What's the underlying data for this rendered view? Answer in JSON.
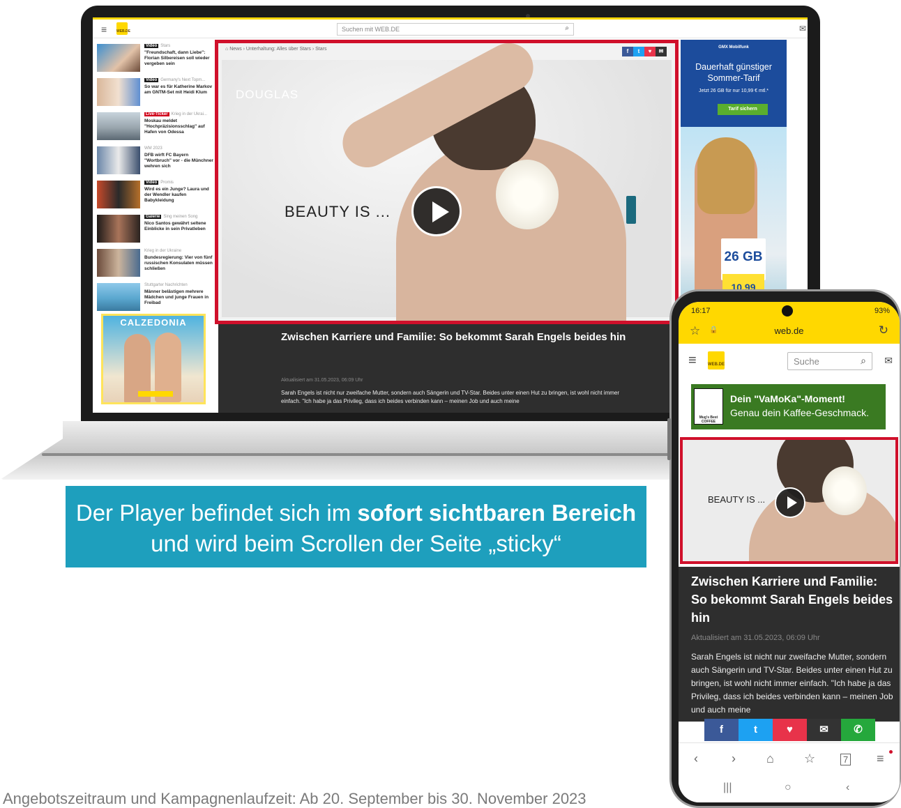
{
  "desktop": {
    "search_placeholder": "Suchen mit WEB.DE",
    "logo_text": "WEB.DE",
    "breadcrumb": "News › Unterhaltung: Alles über Stars › Stars",
    "sidebar": [
      {
        "tag": "Video",
        "category": "Stars",
        "title": "\"Freundschaft, dann Liebe\": Florian Silbereisen soll wieder vergeben sein"
      },
      {
        "tag": "Video",
        "category": "Germany's Next Topm...",
        "title": "So war es für Katherine Markov am GNTM-Set mit Heidi Klum"
      },
      {
        "tag": "Live-Ticker",
        "category": "Krieg in der Ukrai...",
        "title": "Moskau meldet \"Hochpräzisionsschlag\" auf Hafen von Odessa"
      },
      {
        "tag": "",
        "category": "WM 2023",
        "title": "DFB wirft FC Bayern \"Wortbruch\" vor - die Münchner wehren sich"
      },
      {
        "tag": "Video",
        "category": "Promis",
        "title": "Wird es ein Junge? Laura und der Wendler kaufen Babykleidung"
      },
      {
        "tag": "Galerie",
        "category": "Sing meinen Song",
        "title": "Nico Santos gewährt seltene Einblicke in sein Privatleben"
      },
      {
        "tag": "",
        "category": "Krieg in der Ukraine",
        "title": "Bundesregierung: Vier von fünf russischen Konsulaten müssen schließen"
      },
      {
        "tag": "",
        "category": "Stuttgarter Nachrichten",
        "title": "Männer belästigen mehrere Mädchen und junge Frauen in Freibad"
      }
    ],
    "side_ad": {
      "title": "CALZEDONIA"
    },
    "video": {
      "brand": "DOUGLAS",
      "tagline": "BEAUTY IS ..."
    },
    "article": {
      "title": "Zwischen Karriere und Familie: So bekommt Sarah Engels beides hin",
      "date": "Aktualisiert am 31.05.2023, 06:09 Uhr",
      "text": "Sarah Engels ist nicht nur zweifache Mutter, sondern auch Sängerin und TV-Star. Beides unter einen Hut zu bringen, ist wohl nicht immer einfach. \"Ich habe ja das Privileg, dass ich beides verbinden kann – meinen Job und auch meine"
    },
    "right_ad": {
      "brand": "GMX Mobilfunk",
      "headline": "Dauerhaft günstiger Sommer-Tarif",
      "sub": "Jetzt 26 GB für nur 10,99 € mtl.*",
      "cta": "Tarif sichern",
      "gb": "26 GB",
      "price": "10,99"
    }
  },
  "banner": {
    "line1_pre": "Der Player befindet sich im ",
    "line1_bold": "sofort sichtbaren Bereich",
    "line2": "und wird beim Scrollen der Seite „sticky“"
  },
  "footer_note": "Angebotszeitraum und Kampagnenlaufzeit: Ab 20. September bis 30. November 2023",
  "phone": {
    "time": "16:17",
    "battery": "93%",
    "url": "web.de",
    "search_placeholder": "Suche",
    "ad": {
      "line1": "Dein \"VaMoKa\"-Moment!",
      "line2": "Genau dein Kaffee-Geschmack.",
      "logo": "Mug's Best COFFEE"
    },
    "video_tagline": "BEAUTY IS ...",
    "article": {
      "title": "Zwischen Karriere und Familie: So bekommt Sarah Engels beides hin",
      "date": "Aktualisiert am 31.05.2023, 06:09 Uhr",
      "text": "Sarah Engels ist nicht nur zweifache Mutter, sondern auch Sängerin und TV-Star. Beides unter einen Hut zu bringen, ist wohl nicht immer einfach. \"Ich habe ja das Privileg, dass ich beides verbinden kann – meinen Job und auch meine"
    },
    "tab_count": "7"
  },
  "icons": {
    "menu": "≡",
    "search": "⌕",
    "mail": "✉",
    "play": "▶",
    "home": "⌂",
    "back": "‹",
    "forward": "›",
    "star": "☆",
    "lock": "🔒",
    "reload": "↻"
  },
  "colors": {
    "accent_yellow": "#ffd800",
    "highlight_red": "#d0102b",
    "banner_teal": "#1e9fbd",
    "ad_blue": "#1c4c9c",
    "ad_green": "#3a7a22"
  }
}
